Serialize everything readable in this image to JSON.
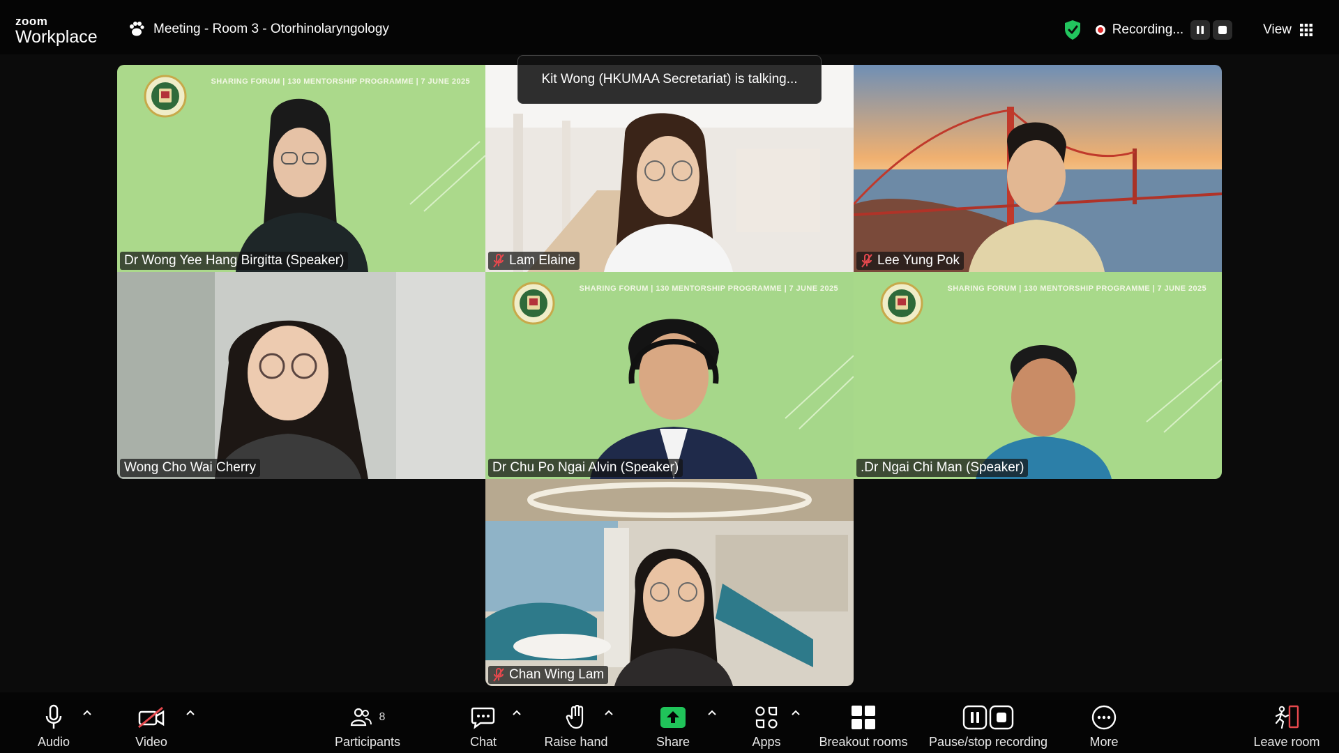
{
  "app": {
    "brand_small": "zoom",
    "brand_large": "Workplace"
  },
  "meeting": {
    "title": "Meeting - Room 3 - Otorhinolaryngology"
  },
  "status": {
    "recording_label": "Recording...",
    "view_label": "View"
  },
  "talking_indicator": "Kit Wong (HKUMAA Secretariat) is talking...",
  "banner": {
    "text": "SHARING FORUM  |  130 MENTORSHIP PROGRAMME  |  7 JUNE 2025"
  },
  "participants": [
    {
      "name": "Dr Wong Yee Hang Birgitta (Speaker)",
      "muted": false
    },
    {
      "name": "Lam Elaine",
      "muted": true
    },
    {
      "name": "Lee Yung Pok",
      "muted": true
    },
    {
      "name": "Wong Cho Wai Cherry",
      "muted": false
    },
    {
      "name": "Dr Chu Po Ngai Alvin (Speaker)",
      "muted": false
    },
    {
      "name": ".Dr Ngai Chi Man (Speaker)",
      "muted": false
    },
    {
      "name": "Chan Wing Lam",
      "muted": true
    }
  ],
  "toolbar": {
    "audio": "Audio",
    "video": "Video",
    "participants": "Participants",
    "participants_count": "8",
    "chat": "Chat",
    "raise_hand": "Raise hand",
    "share": "Share",
    "apps": "Apps",
    "breakout": "Breakout rooms",
    "pause_recording": "Pause/stop recording",
    "more": "More",
    "leave": "Leave room"
  },
  "colors": {
    "background": "#0b0b0b",
    "banner_green": "#a8d98a",
    "share_green": "#20c45a",
    "shield_green": "#22c55e",
    "leave_red": "#e5484d"
  }
}
